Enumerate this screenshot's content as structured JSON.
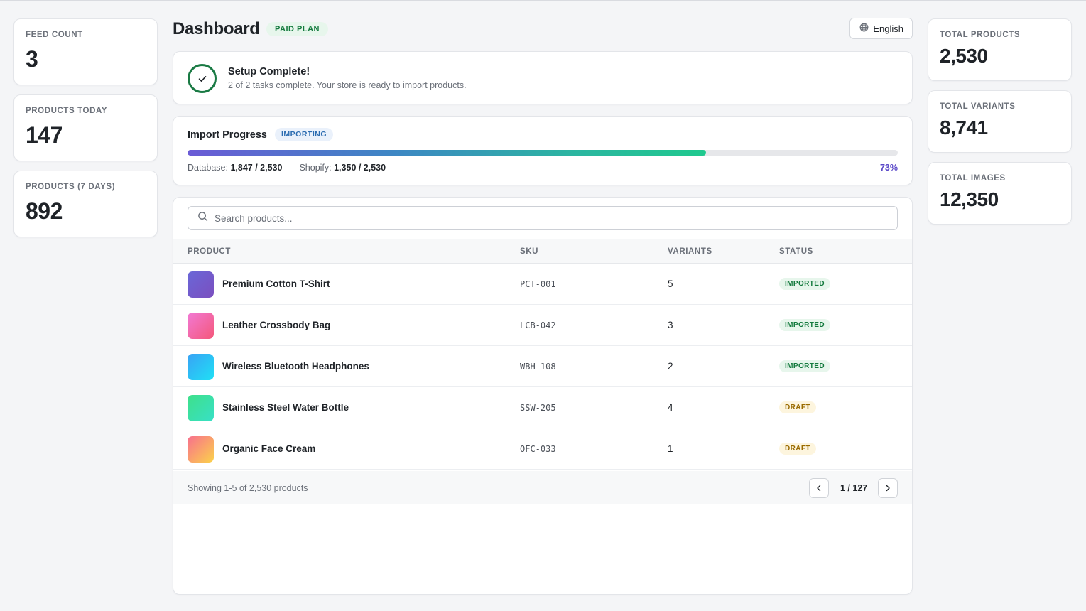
{
  "left_stats": [
    {
      "label": "FEED COUNT",
      "value": "3"
    },
    {
      "label": "PRODUCTS TODAY",
      "value": "147"
    },
    {
      "label": "PRODUCTS (7 DAYS)",
      "value": "892"
    }
  ],
  "right_stats": [
    {
      "label": "TOTAL PRODUCTS",
      "value": "2,530"
    },
    {
      "label": "TOTAL VARIANTS",
      "value": "8,741"
    },
    {
      "label": "TOTAL IMAGES",
      "value": "12,350"
    }
  ],
  "header": {
    "title": "Dashboard",
    "plan_badge": "PAID PLAN",
    "language": "English"
  },
  "setup": {
    "title": "Setup Complete!",
    "subtitle": "2 of 2 tasks complete. Your store is ready to import products."
  },
  "import_progress": {
    "title": "Import Progress",
    "status": "IMPORTING",
    "percent_value": 73,
    "percent_label": "73%",
    "database_label": "Database:",
    "database_value": "1,847 / 2,530",
    "shopify_label": "Shopify:",
    "shopify_value": "1,350 / 2,530"
  },
  "search": {
    "placeholder": "Search products..."
  },
  "table": {
    "columns": {
      "product": "PRODUCT",
      "sku": "SKU",
      "variants": "VARIANTS",
      "status": "STATUS"
    },
    "rows": [
      {
        "name": "Premium Cotton T-Shirt",
        "sku": "PCT-001",
        "variants": "5",
        "status": "IMPORTED",
        "status_kind": "imported",
        "thumb_from": "#6a67d8",
        "thumb_to": "#7b4fbf"
      },
      {
        "name": "Leather Crossbody Bag",
        "sku": "LCB-042",
        "variants": "3",
        "status": "IMPORTED",
        "status_kind": "imported",
        "thumb_from": "#f27ad5",
        "thumb_to": "#f4577a"
      },
      {
        "name": "Wireless Bluetooth Headphones",
        "sku": "WBH-108",
        "variants": "2",
        "status": "IMPORTED",
        "status_kind": "imported",
        "thumb_from": "#39a2f5",
        "thumb_to": "#1fe0f5"
      },
      {
        "name": "Stainless Steel Water Bottle",
        "sku": "SSW-205",
        "variants": "4",
        "status": "DRAFT",
        "status_kind": "draft",
        "thumb_from": "#3ee08a",
        "thumb_to": "#38e0c6"
      },
      {
        "name": "Organic Face Cream",
        "sku": "OFC-033",
        "variants": "1",
        "status": "DRAFT",
        "status_kind": "draft",
        "thumb_from": "#f86f8e",
        "thumb_to": "#fbd24a"
      }
    ]
  },
  "footer": {
    "showing": "Showing 1-5 of 2,530 products",
    "page": "1 / 127"
  },
  "colors": {
    "accent_green": "#1a7a44",
    "progress_purple": "#5a48c8"
  }
}
